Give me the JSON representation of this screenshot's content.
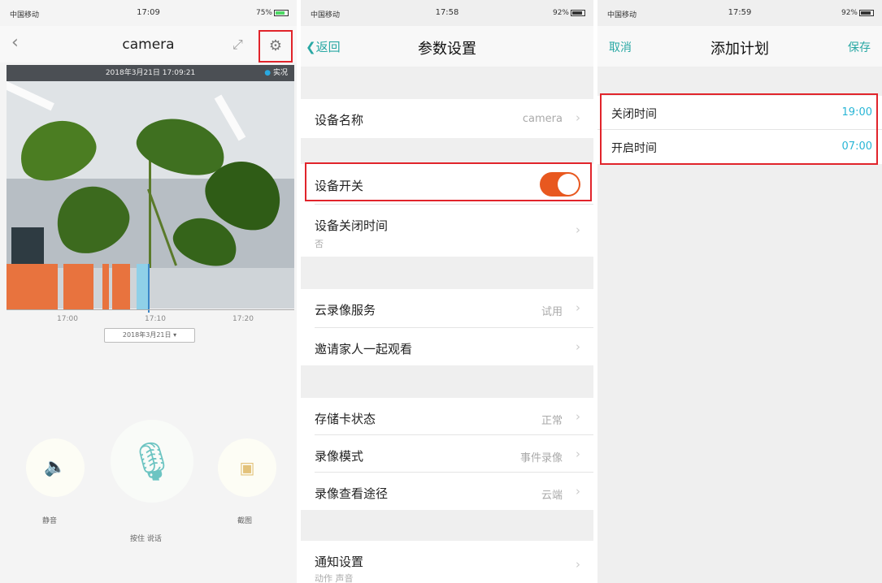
{
  "colors": {
    "accent": "#29a8a4",
    "toggle_on": "#e8581f",
    "highlight": "#e1242b",
    "timeline_orange": "#e8733e",
    "time_value": "#29b6d6"
  },
  "screen1": {
    "status": {
      "carrier": "中国移动",
      "time": "17:09",
      "battery": "75%"
    },
    "nav": {
      "back_icon": "chevron-left",
      "title": "camera",
      "expand_icon": "expand-arrows",
      "settings_icon": "gear"
    },
    "video": {
      "timestamp": "2018年3月21日 17:09:21",
      "live_label": "实况"
    },
    "timeline": {
      "ticks": [
        "17:00",
        "17:10",
        "17:20"
      ],
      "date": "2018年3月21日"
    },
    "controls": {
      "mute_label": "静音",
      "talk_label": "按住 说话",
      "screenshot_label": "截图"
    }
  },
  "screen2": {
    "status": {
      "carrier": "中国移动",
      "time": "17:58",
      "battery": "92%"
    },
    "nav": {
      "back": "返回",
      "title": "参数设置"
    },
    "rows": {
      "device_name": {
        "label": "设备名称",
        "value": "camera"
      },
      "device_switch": {
        "label": "设备开关",
        "on": true
      },
      "off_time": {
        "label": "设备关闭时间",
        "sub": "否"
      },
      "cloud": {
        "label": "云录像服务",
        "value": "试用"
      },
      "invite": {
        "label": "邀请家人一起观看"
      },
      "storage": {
        "label": "存储卡状态",
        "value": "正常"
      },
      "rec_mode": {
        "label": "录像模式",
        "value": "事件录像"
      },
      "rec_path": {
        "label": "录像查看途径",
        "value": "云端"
      },
      "notify": {
        "label": "通知设置",
        "sub": "动作 声音"
      }
    }
  },
  "screen3": {
    "status": {
      "carrier": "中国移动",
      "time": "17:59",
      "battery": "92%"
    },
    "nav": {
      "cancel": "取消",
      "title": "添加计划",
      "save": "保存"
    },
    "rows": {
      "off": {
        "label": "关闭时间",
        "value": "19:00"
      },
      "on": {
        "label": "开启时间",
        "value": "07:00"
      }
    }
  }
}
